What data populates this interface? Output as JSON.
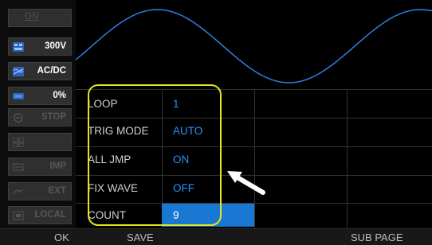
{
  "sidebar": {
    "on_label": "ON",
    "voltage_label": "300V",
    "coupling_label": "AC/DC",
    "percent_label": "0%",
    "stop_label": "STOP",
    "imp_label": "IMP",
    "ext_label": "EXT",
    "local_label": "LOCAL"
  },
  "settings": [
    {
      "label": "LOOP",
      "value": "1"
    },
    {
      "label": "TRIG MODE",
      "value": "AUTO"
    },
    {
      "label": "ALL JMP",
      "value": "ON"
    },
    {
      "label": "FIX WAVE",
      "value": "OFF"
    },
    {
      "label": "COUNT",
      "value": "9"
    }
  ],
  "softkeys": {
    "ok": "OK",
    "save": "SAVE",
    "sub_page": "SUB PAGE"
  },
  "colors": {
    "value_text": "#2b8fff",
    "selected_cell": "#1978d2",
    "highlight_box": "#e5e51b",
    "waveform": "#2f7fe0"
  },
  "icons": {
    "voltage": "range-icon",
    "coupling": "ac-dc-icon",
    "percent": "bar-icon",
    "stop": "stop-icon",
    "imp": "impedance-icon",
    "ext": "external-icon",
    "local": "local-icon"
  }
}
